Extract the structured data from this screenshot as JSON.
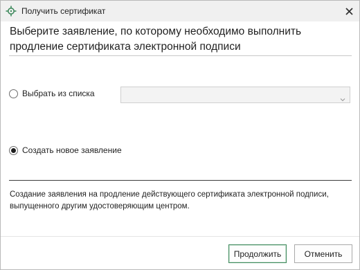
{
  "window": {
    "title": "Получить сертификат",
    "accent_color": "#3f8a5d"
  },
  "icons": {
    "app": "crosshair-target-icon",
    "close": "close-icon",
    "dropdown": "chevron-down-icon"
  },
  "heading": "Выберите заявление, по которому необходимо выполнить продление сертификата электронной подписи",
  "options": {
    "from_list": {
      "label": "Выбрать из списка",
      "selected": false
    },
    "create_new": {
      "label": "Создать новое заявление",
      "selected": true
    }
  },
  "list_select": {
    "value": "",
    "disabled": true
  },
  "description_line1": "Создание заявления на продление действующего сертификата электронной подписи,",
  "description_line2": "выпущенного другим удостоверяющим центром.",
  "buttons": {
    "continue": "Продолжить",
    "cancel": "Отменить"
  }
}
